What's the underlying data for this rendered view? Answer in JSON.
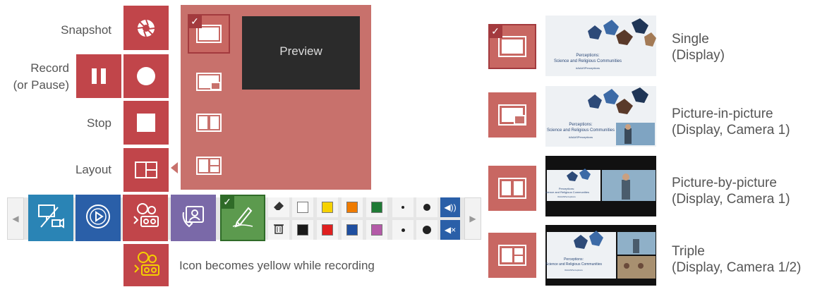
{
  "labels": {
    "snapshot": "Snapshot",
    "record_line1": "Record",
    "record_line2": "(or Pause)",
    "stop": "Stop",
    "layout": "Layout"
  },
  "preview": {
    "label": "Preview"
  },
  "note": "Icon becomes yellow while recording",
  "layouts": [
    {
      "title": "Single",
      "subtitle": "(Display)",
      "selected": true
    },
    {
      "title": "Picture-in-picture",
      "subtitle": "(Display, Camera 1)",
      "selected": false
    },
    {
      "title": "Picture-by-picture",
      "subtitle": "(Display, Camera 1)",
      "selected": false
    },
    {
      "title": "Triple",
      "subtitle": "(Display, Camera 1/2)",
      "selected": false
    }
  ],
  "thumbnail_text": {
    "title_line1": "Perceptions:",
    "title_line2": "Science and Religious Communities",
    "hashtag": "#AAASPerceptions"
  },
  "icons": {
    "snapshot": "aperture-icon",
    "pause": "pause-icon",
    "record": "record-icon",
    "stop": "stop-icon",
    "layout": "layout-icon",
    "screen_camera": "screen-camera-icon",
    "play": "play-icon",
    "recorder": "recorder-icon",
    "call": "phone-contact-icon",
    "pen": "pen-icon",
    "eraser": "eraser-icon",
    "trash": "trash-icon",
    "volume_on": "volume-icon",
    "volume_mute": "mute-icon",
    "checkmark": "check-icon"
  },
  "colors": {
    "accent": "#c1454a",
    "panel": "#c8716c",
    "blue": "#2a5fa8",
    "teal": "#2a84b5",
    "purple": "#7a69a8",
    "green": "#5c9a4e",
    "yellow": "#f5d000"
  },
  "palette": [
    "#ffffff",
    "#f6d200",
    "#ef7b00",
    "#1f7a35",
    "#1a1a1a",
    "#e02020",
    "#1f4fa0",
    "#b45aa8"
  ]
}
